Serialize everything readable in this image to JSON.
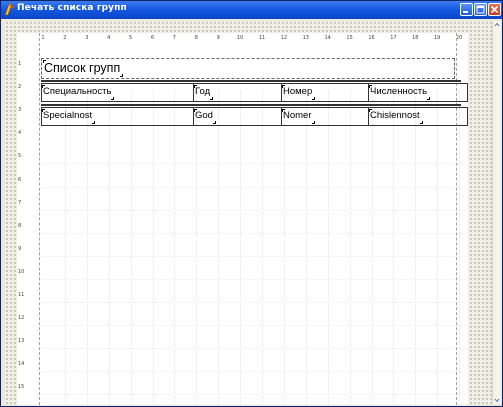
{
  "window": {
    "title": "Печать списка групп"
  },
  "ruler": {
    "horizontal": [
      "1",
      "2",
      "3",
      "4",
      "5",
      "6",
      "7",
      "8",
      "9",
      "10",
      "11",
      "12",
      "13",
      "14",
      "15",
      "16",
      "17",
      "18",
      "19",
      "20"
    ],
    "vertical": [
      "1",
      "2",
      "3",
      "4",
      "5",
      "6",
      "7",
      "8",
      "9",
      "10",
      "11",
      "12",
      "13",
      "14",
      "15"
    ]
  },
  "report": {
    "title": "Список групп",
    "headers": [
      "Специальность",
      "Год",
      "Номер",
      "Численность"
    ],
    "fields": [
      "Specialnost",
      "God",
      "Nomer",
      "Chislennost"
    ]
  },
  "icons": {
    "app": "delphi-app-icon",
    "minimize": "minimize-icon",
    "maximize": "maximize-icon",
    "close": "close-icon"
  },
  "colors": {
    "titlebar": "#1659e0",
    "close_button": "#c8401e",
    "designer_background": "#f0efe6"
  }
}
